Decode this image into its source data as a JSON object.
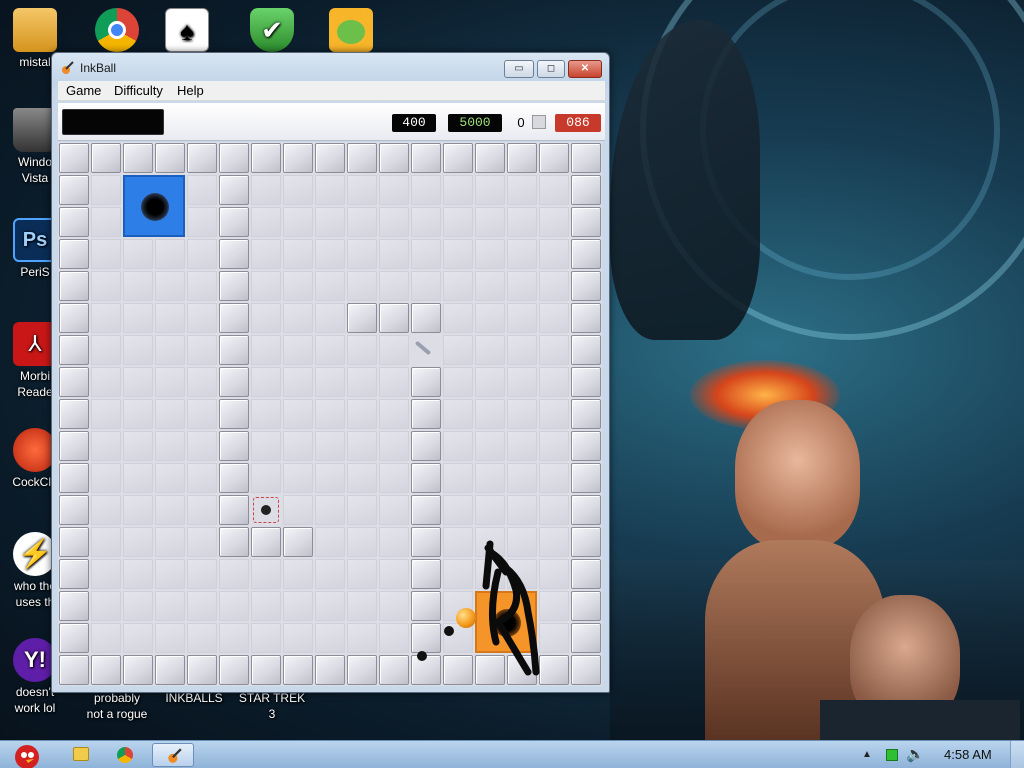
{
  "desktop": {
    "icons": [
      {
        "label": "mistal",
        "icon": "folder-icon"
      },
      {
        "label": "",
        "icon": "chrome-icon"
      },
      {
        "label": "",
        "icon": "solitaire-icon"
      },
      {
        "label": "",
        "icon": "shield-icon"
      },
      {
        "label": "",
        "icon": "angry-birds-icon"
      },
      {
        "label": "Windo\nVista",
        "icon": "recycle-bin-icon"
      },
      {
        "label": "PeriS",
        "icon": "photoshop-icon"
      },
      {
        "label": "Morbi\nReade",
        "icon": "pdf-reader-icon"
      },
      {
        "label": "CockCle",
        "icon": "broom-icon"
      },
      {
        "label": "who the\nuses th",
        "icon": "lightning-icon"
      },
      {
        "label": "doesn't\nwork lol",
        "icon": "yahoo-icon"
      },
      {
        "label": "probably\nnot a rogue",
        "icon": "app-icon"
      },
      {
        "label": "INKBALLS",
        "icon": "app-icon"
      },
      {
        "label": "STAR TREK\n3",
        "icon": "app-icon"
      }
    ]
  },
  "window": {
    "title": "InkBall",
    "title_icon": "inkball-icon",
    "controls": {
      "minimize": "▭",
      "maximize": "◻",
      "close": "✕"
    },
    "menu": [
      "Game",
      "Difficulty",
      "Help"
    ],
    "status": {
      "score": "400",
      "target": "5000",
      "balls_count": "0",
      "timer": "086"
    }
  },
  "colors": {
    "blue_hole": "#2d7ee6",
    "orange_hole": "#f59428",
    "timer_bg": "#c7392b",
    "target_text": "#9be07a"
  },
  "taskbar": {
    "start_icon": "angry-bird-start-icon",
    "buttons": [
      "explorer-icon",
      "chrome-icon",
      "inkball-icon"
    ],
    "clock": "4:58 AM"
  }
}
